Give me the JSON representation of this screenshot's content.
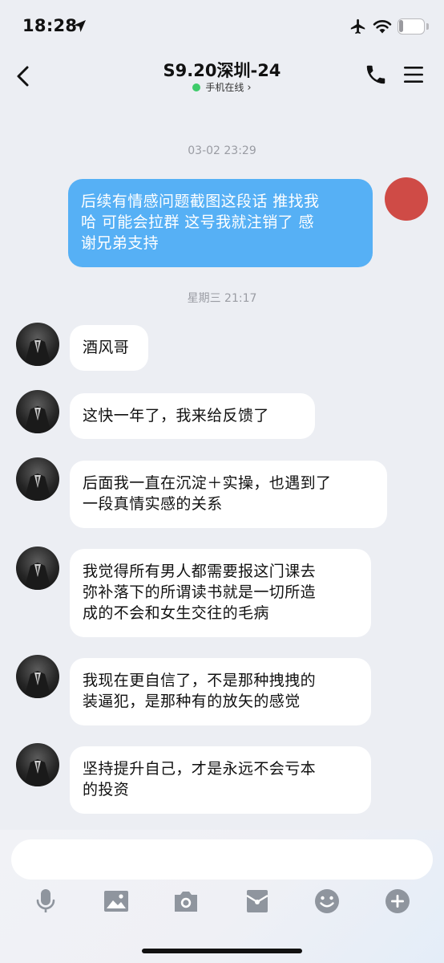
{
  "status_bar": {
    "time": "18:28",
    "battery_level": "18",
    "icons": [
      "location-arrow-icon",
      "airplane-icon",
      "wifi-icon",
      "battery-icon"
    ]
  },
  "header": {
    "title": "S9.20深圳-24",
    "subtitle": "手机在线",
    "subtitle_chevron": "›",
    "online_color": "#3ecb6a",
    "icons": [
      "back-chevron-icon",
      "phone-icon",
      "menu-icon"
    ]
  },
  "messages": [
    {
      "type": "timestamp",
      "text": "03-02 23:29"
    },
    {
      "type": "outgoing",
      "lines": [
        "后续有情感问题截图这段话 推找我",
        "哈 可能会拉群 这号我就注销了 感",
        "谢兄弟支持"
      ]
    },
    {
      "type": "timestamp",
      "text": "星期三 21:17"
    },
    {
      "type": "incoming",
      "lines": [
        "酒风哥"
      ]
    },
    {
      "type": "incoming",
      "lines": [
        "这快一年了，我来给反馈了"
      ]
    },
    {
      "type": "incoming",
      "lines": [
        "后面我一直在沉淀＋实操，也遇到了",
        "一段真情实感的关系"
      ]
    },
    {
      "type": "incoming",
      "lines": [
        "我觉得所有男人都需要报这门课去",
        "弥补落下的所谓读书就是一切所造",
        "成的不会和女生交往的毛病"
      ]
    },
    {
      "type": "incoming",
      "lines": [
        "我现在更自信了，不是那种拽拽的",
        "装逼犯，是那种有的放矢的感觉"
      ]
    },
    {
      "type": "incoming",
      "lines": [
        "坚持提升自己，才是永远不会亏本",
        "的投资"
      ]
    }
  ],
  "input": {
    "value": "",
    "placeholder": ""
  },
  "toolbar": [
    "microphone-icon",
    "image-icon",
    "camera-icon",
    "red-packet-icon",
    "emoji-icon",
    "plus-icon"
  ],
  "colors": {
    "background": "#eceef3",
    "outgoing_bubble": "#56b0f5",
    "incoming_bubble": "#ffffff",
    "self_avatar": "#cf4b46",
    "icon_gray": "#8f959e"
  }
}
